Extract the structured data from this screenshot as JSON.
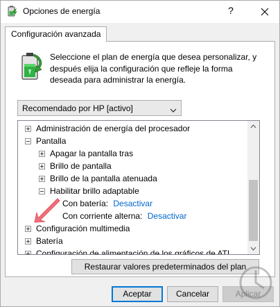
{
  "window": {
    "title": "Opciones de energía",
    "help_glyph": "?",
    "close_icon": "close-icon",
    "app_icon": "power-options-icon"
  },
  "tab": {
    "label": "Configuración avanzada"
  },
  "intro": {
    "icon": "battery-plan-icon",
    "text": "Seleccione el plan de energía que desea personalizar, y después elija la configuración que refleje la forma deseada para administrar la energía."
  },
  "plan_select": {
    "value": "Recomendado por HP [activo]"
  },
  "tree": {
    "rows": [
      {
        "label": "Administración de energía del procesador",
        "state": "collapsed"
      },
      {
        "label": "Pantalla",
        "state": "expanded"
      },
      {
        "label": "Apagar la pantalla tras",
        "state": "collapsed"
      },
      {
        "label": "Brillo de pantalla",
        "state": "collapsed"
      },
      {
        "label": "Brillo de la pantalla atenuada",
        "state": "collapsed"
      },
      {
        "label": "Habilitar brillo adaptable",
        "state": "expanded"
      },
      {
        "label": "Con batería:",
        "value": "Desactivar"
      },
      {
        "label": "Con corriente alterna:",
        "value": "Desactivar"
      },
      {
        "label": "Configuración multimedia",
        "state": "collapsed"
      },
      {
        "label": "Batería",
        "state": "collapsed"
      },
      {
        "label": "Configuración de alimentación de los gráficos de ATI",
        "state": "collapsed"
      }
    ]
  },
  "buttons": {
    "restore": "Restaurar valores predeterminados del plan",
    "ok": "Aceptar",
    "cancel": "Cancelar",
    "apply": "Aplicar"
  },
  "colors": {
    "link": "#0066cc",
    "annotation_arrow": "#f0707a",
    "focus_border": "#0078d7"
  }
}
